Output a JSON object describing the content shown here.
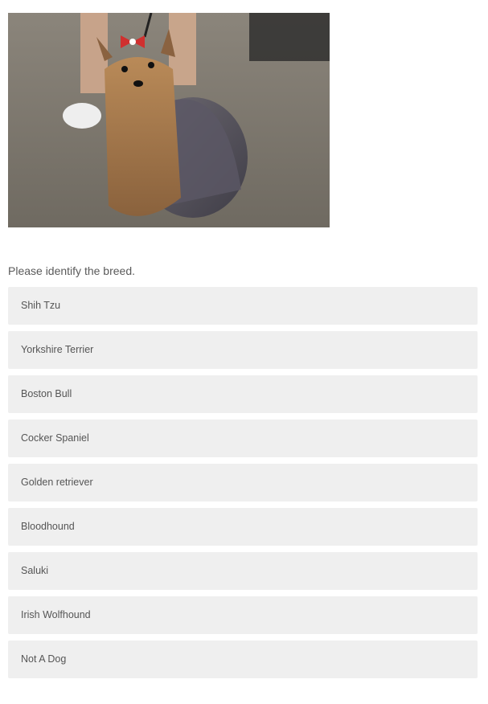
{
  "question": {
    "image_alt": "Yorkshire Terrier with a red bow standing on a leash",
    "prompt": "Please identify the breed."
  },
  "answers": [
    {
      "label": "Shih Tzu"
    },
    {
      "label": "Yorkshire Terrier"
    },
    {
      "label": "Boston Bull"
    },
    {
      "label": "Cocker Spaniel"
    },
    {
      "label": "Golden retriever"
    },
    {
      "label": "Bloodhound"
    },
    {
      "label": "Saluki"
    },
    {
      "label": "Irish Wolfhound"
    },
    {
      "label": "Not A Dog"
    }
  ],
  "colors": {
    "answer_background": "#efefef",
    "text": "#555555"
  }
}
